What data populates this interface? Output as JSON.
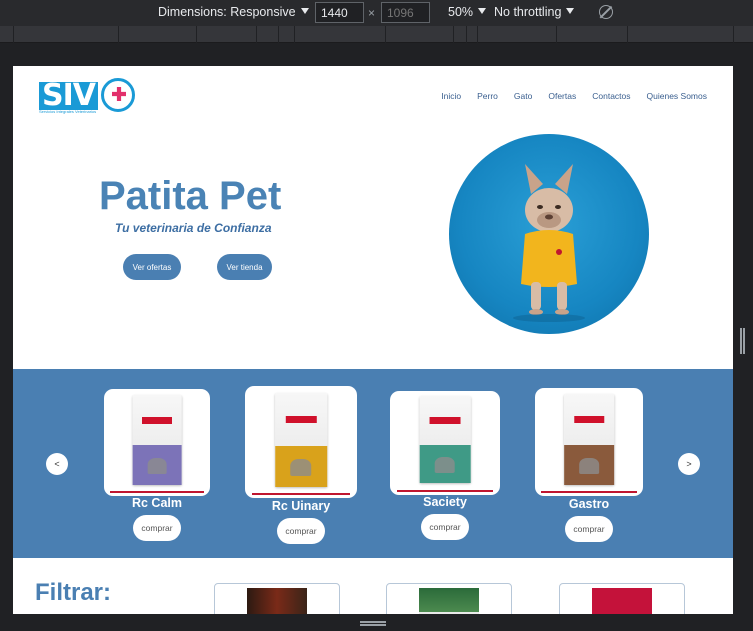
{
  "devtools": {
    "dimensions_label": "Dimensions: Responsive",
    "width_value": "1440",
    "height_placeholder": "1096",
    "zoom": "50%",
    "throttling": "No throttling",
    "times_sign": "×"
  },
  "site": {
    "logo_text": "SIV",
    "logo_subtitle": "Servicios Integrales Veterinarios",
    "nav": [
      "Inicio",
      "Perro",
      "Gato",
      "Ofertas",
      "Contactos",
      "Quienes Somos"
    ],
    "hero": {
      "title": "Patita Pet",
      "subtitle": "Tu veterinaria de Confianza",
      "btn_offers": "Ver ofertas",
      "btn_store": "Ver tienda"
    },
    "carousel": {
      "prev": "<",
      "next": ">",
      "products": [
        {
          "name": "Rc Calm",
          "buy": "comprar",
          "stripe": "#7c73b8"
        },
        {
          "name": "Rc Uinary",
          "buy": "comprar",
          "stripe": "#d9a21b"
        },
        {
          "name": "Saciety",
          "buy": "comprar",
          "stripe": "#3f9a86"
        },
        {
          "name": "Gastro",
          "buy": "comprar",
          "stripe": "#8a5a3c"
        }
      ]
    },
    "filter_title": "Filtrar:"
  },
  "colors": {
    "brand": "#4a7fb2",
    "hero_title": "#4a83b5",
    "logo_blue": "#1a9ad6"
  }
}
